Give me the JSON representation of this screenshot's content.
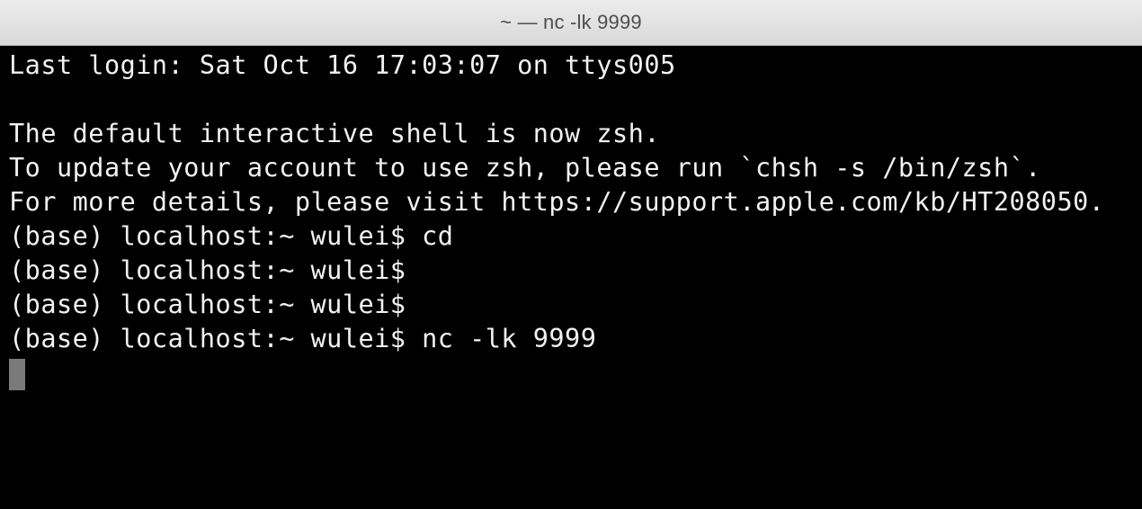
{
  "window": {
    "title": "~ — nc -lk 9999"
  },
  "terminal": {
    "lines": [
      "Last login: Sat Oct 16 17:03:07 on ttys005",
      "",
      "The default interactive shell is now zsh.",
      "To update your account to use zsh, please run `chsh -s /bin/zsh`.",
      "For more details, please visit https://support.apple.com/kb/HT208050.",
      "(base) localhost:~ wulei$ cd",
      "(base) localhost:~ wulei$",
      "(base) localhost:~ wulei$",
      "(base) localhost:~ wulei$ nc -lk 9999"
    ]
  }
}
